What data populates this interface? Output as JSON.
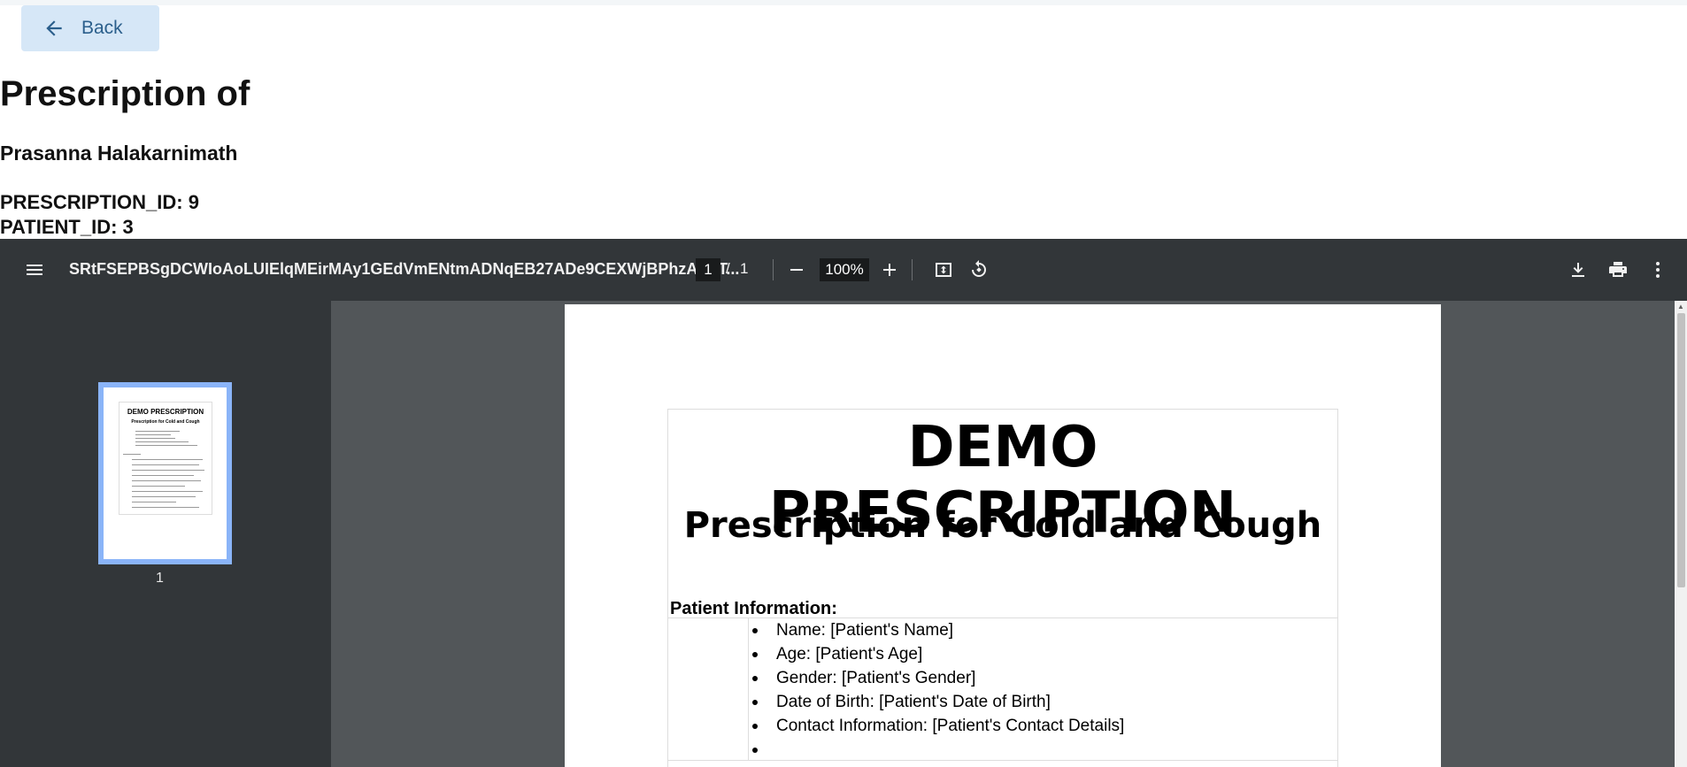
{
  "header": {
    "back_label": "Back",
    "title": "Prescription of",
    "patient_name": "Prasanna Halakarnimath",
    "prescription_id": "PRESCRIPTION_ID: 9",
    "patient_id": "PATIENT_ID: 3"
  },
  "viewer": {
    "file_name": "SRtFSEPBSgDCWIoAoLUIElqMEirMAy1GEdVmENtmADNqEB27ADe9CEXWjBPhzAEbT...",
    "current_page": "1",
    "page_separator": "/",
    "total_pages": "1",
    "zoom": "100%",
    "thumbnail_label": "1"
  },
  "document": {
    "heading": "DEMO PRESCRIPTION",
    "subheading": "Prescription for Cold and Cough",
    "section_title": "Patient Information:",
    "patient_fields": [
      "Name: [Patient's Name]",
      "Age: [Patient's Age]",
      "Gender: [Patient's Gender]",
      "Date of Birth: [Patient's Date of Birth]",
      "Contact Information: [Patient's Contact Details]",
      ""
    ]
  },
  "thumbnail": {
    "heading": "DEMO PRESCRIPTION",
    "subheading": "Prescription for Cold and Cough"
  },
  "icons": {
    "back": "arrow-left-icon",
    "menu": "menu-icon",
    "zoom_out": "minus-icon",
    "zoom_in": "plus-icon",
    "fit": "fit-page-icon",
    "rotate": "rotate-icon",
    "download": "download-icon",
    "print": "print-icon",
    "more": "more-vert-icon"
  },
  "colors": {
    "back_button_bg": "#d6e7f7",
    "back_button_text": "#2b5f8c",
    "toolbar_bg": "#323639",
    "viewer_bg": "#525659",
    "thumbnail_border": "#8ab4f8"
  }
}
